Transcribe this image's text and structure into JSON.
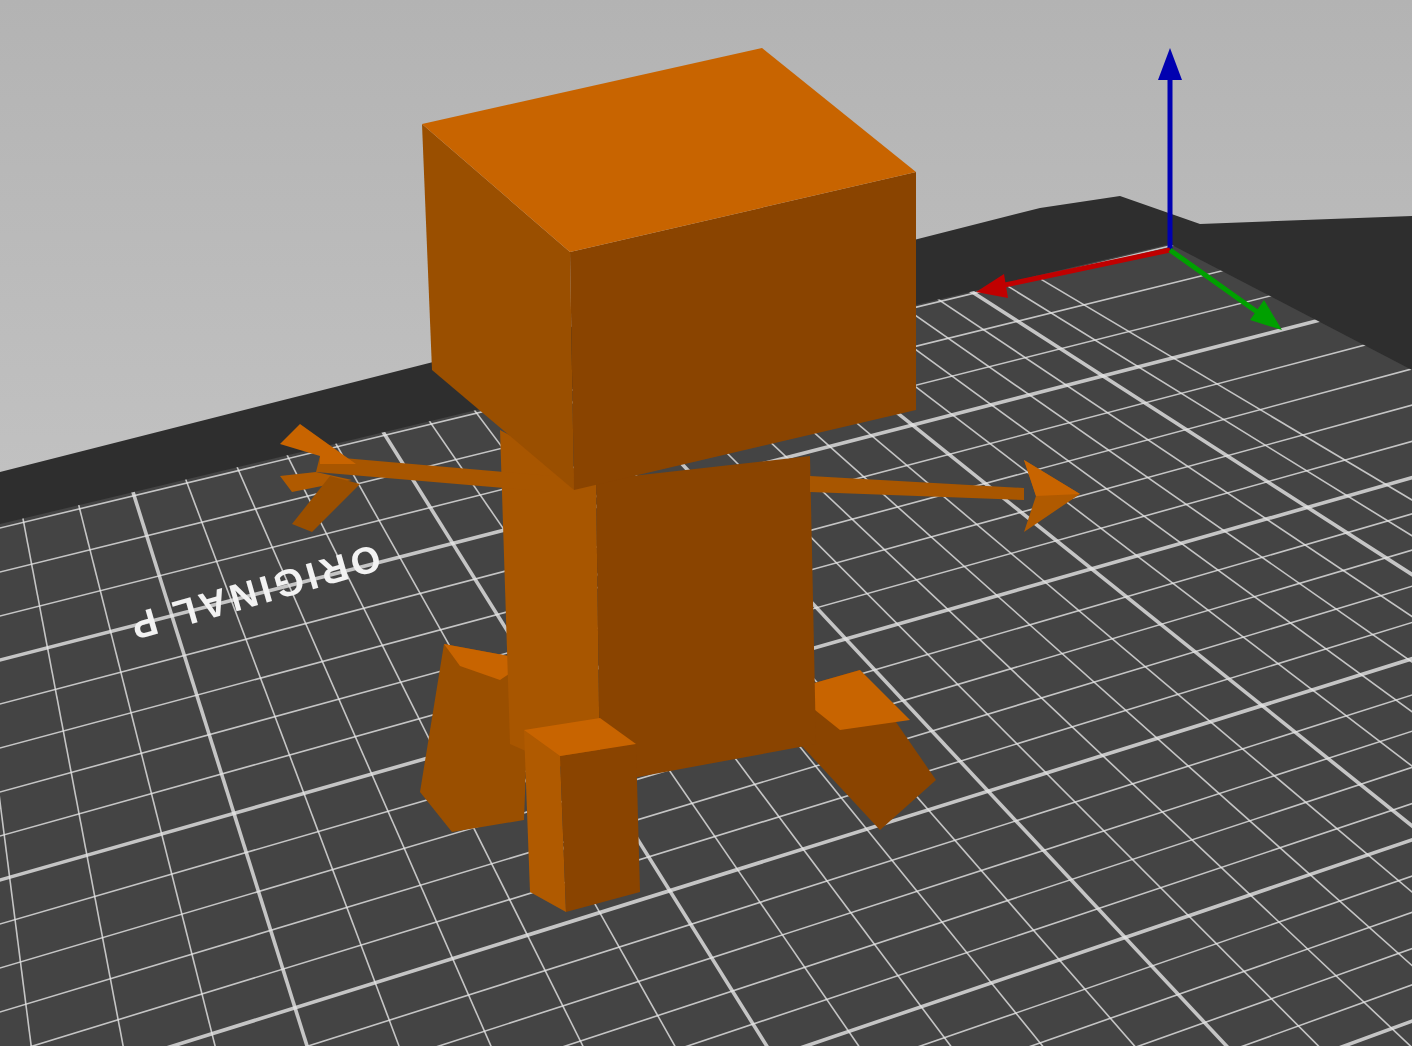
{
  "viewport": {
    "bed_label": "ORIGINAL P"
  }
}
